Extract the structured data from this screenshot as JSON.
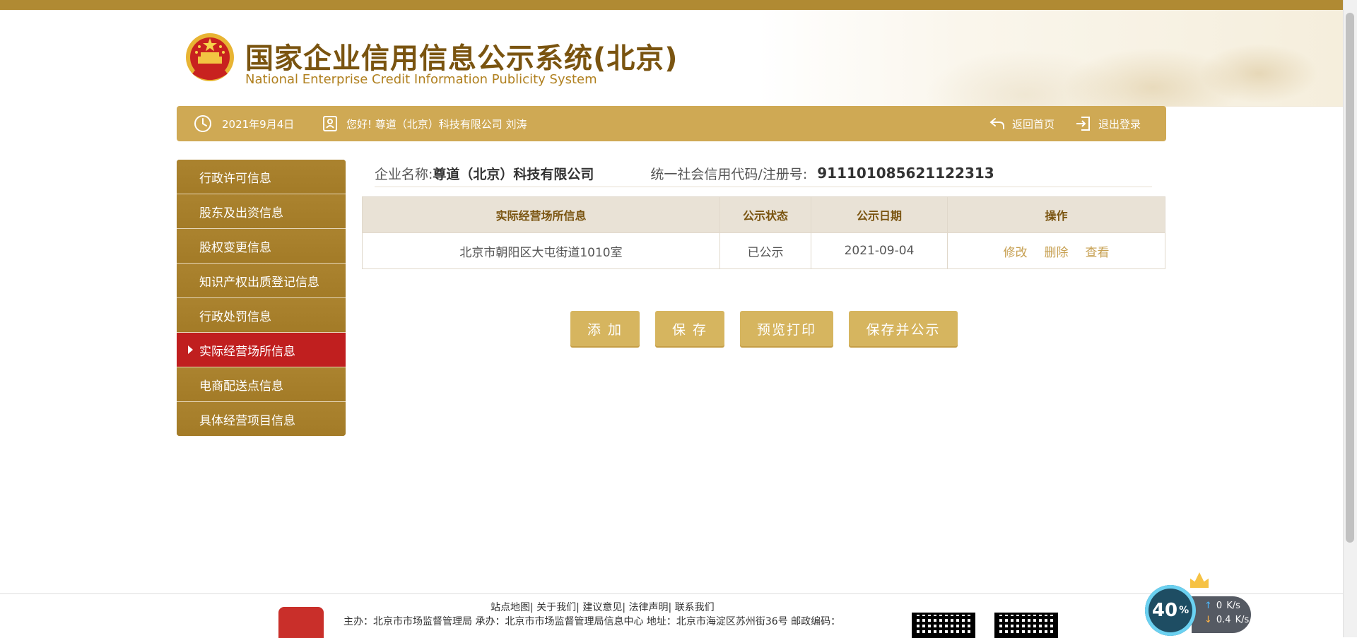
{
  "header": {
    "title_zh": "国家企业信用信息公示系统(北京)",
    "title_en": "National Enterprise Credit Information Publicity System"
  },
  "userbar": {
    "date": "2021年9月4日",
    "greeting": "您好! 尊道（北京）科技有限公司 刘涛",
    "home_link": "返回首页",
    "logout_link": "退出登录",
    "bar_color": "#cfa954"
  },
  "sidebar": {
    "items": [
      {
        "label": "行政许可信息"
      },
      {
        "label": "股东及出资信息"
      },
      {
        "label": "股权变更信息"
      },
      {
        "label": "知识产权出质登记信息"
      },
      {
        "label": "行政处罚信息"
      },
      {
        "label": "实际经营场所信息"
      },
      {
        "label": "电商配送点信息"
      },
      {
        "label": "具体经营项目信息"
      }
    ],
    "active_index": 5,
    "active_color": "#c01f1f",
    "item_color": "#a9802c"
  },
  "company": {
    "name_label": "企业名称:",
    "name_value": "尊道（北京）科技有限公司",
    "code_label": "统一社会信用代码/注册号:",
    "code_value": "911101085621122313"
  },
  "table": {
    "columns": [
      "实际经营场所信息",
      "公示状态",
      "公示日期",
      "操作"
    ],
    "rows": [
      {
        "address": "北京市朝阳区大屯街道1010室",
        "status": "已公示",
        "date": "2021-09-04",
        "ops": [
          "修改",
          "删除",
          "查看"
        ]
      }
    ]
  },
  "buttons": {
    "add": "添 加",
    "save": "保 存",
    "preview": "预览打印",
    "save_publish": "保存并公示"
  },
  "footer": {
    "links": [
      "站点地图",
      "关于我们",
      "建议意见",
      "法律声明",
      "联系我们"
    ],
    "info": "主办：北京市市场监督管理局 承办：北京市市场监督管理局信息中心 地址：北京市海淀区苏州街36号 邮政编码："
  },
  "netwidget": {
    "percent": "40",
    "pct_sign": "%",
    "up_speed": "0",
    "down_speed": "0.4",
    "unit": "K/s"
  },
  "icons": {
    "clock": "clock-icon",
    "user": "user-card-icon",
    "home": "return-arrow-icon",
    "logout": "logout-icon"
  }
}
